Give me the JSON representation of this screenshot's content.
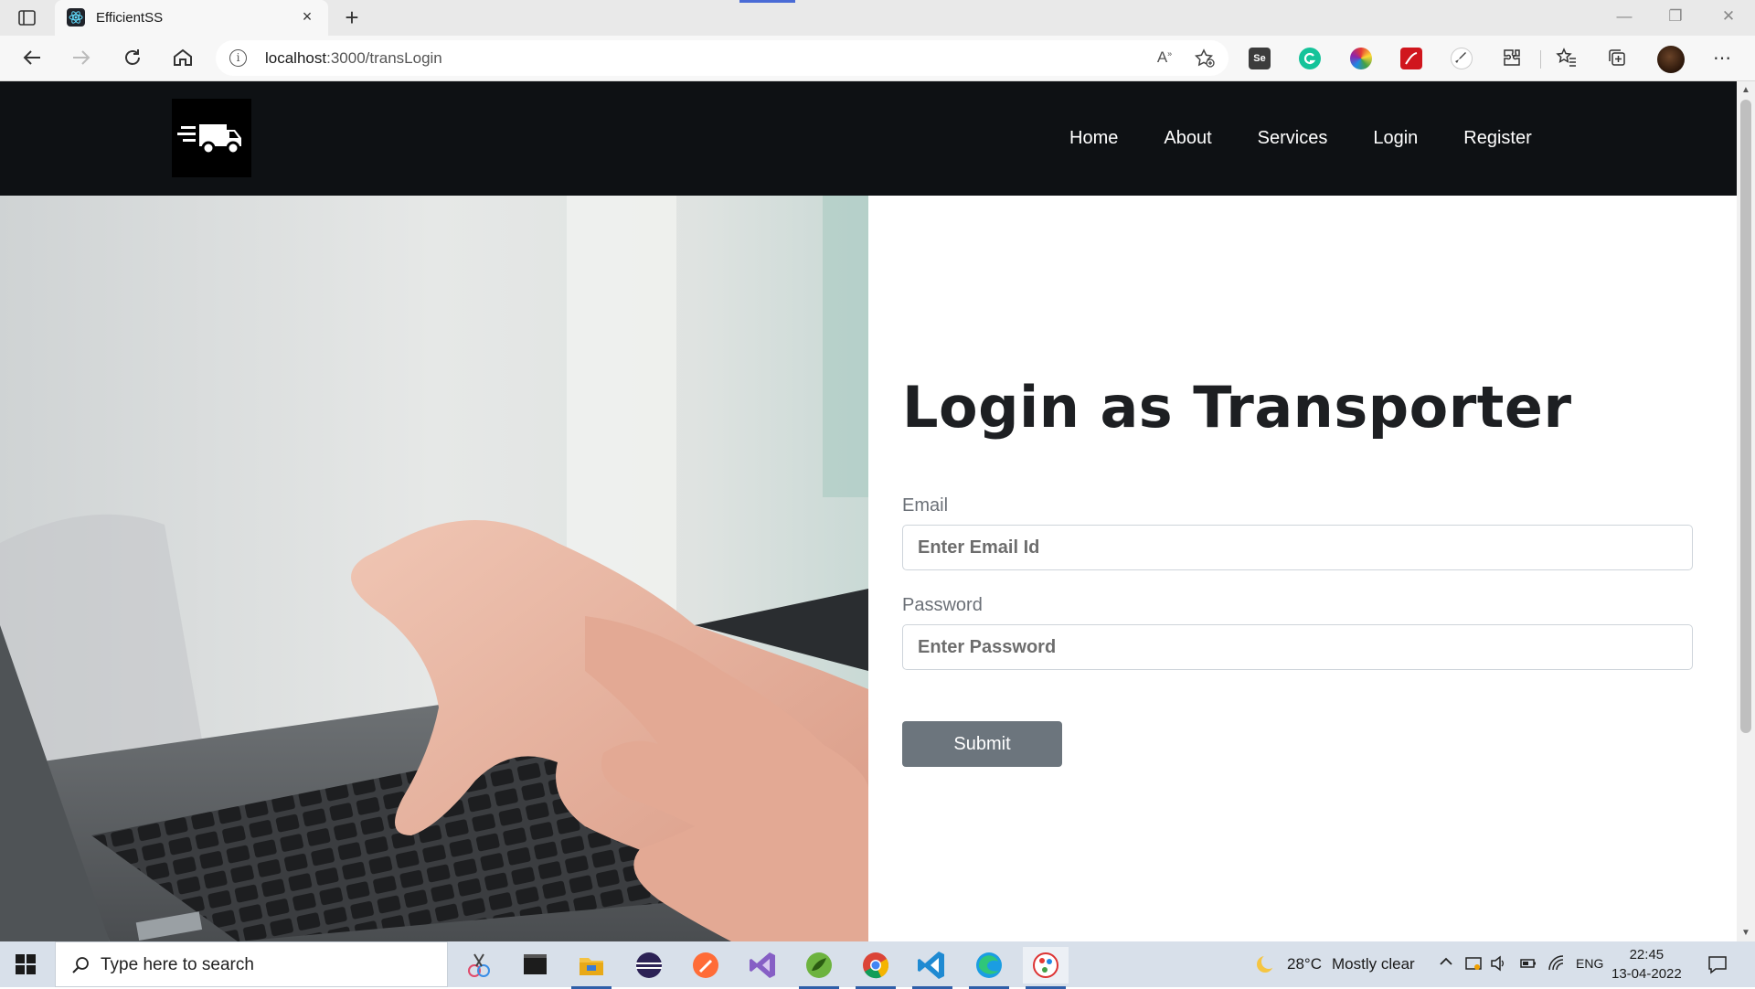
{
  "browser": {
    "tab_title": "EfficientSS",
    "tab_close": "×",
    "new_tab": "+",
    "url_host": "localhost",
    "url_path": ":3000/transLogin",
    "window_controls": {
      "minimize": "—",
      "restore": "❐",
      "close": "✕"
    },
    "extensions": [
      "selenium-ide-extension",
      "grammarly-extension",
      "color-picker-extension",
      "pdf-extension",
      "rocket-extension",
      "extensions-icon"
    ],
    "selenium_label": "Se"
  },
  "site": {
    "logo": "delivery-truck-logo",
    "nav": [
      "Home",
      "About",
      "Services",
      "Login",
      "Register"
    ]
  },
  "login_form": {
    "title": "Login as Transporter",
    "email_label": "Email",
    "email_placeholder": "Enter Email Id",
    "password_label": "Password",
    "password_placeholder": "Enter Password",
    "submit_label": "Submit"
  },
  "taskbar": {
    "search_placeholder": "Type here to search",
    "weather_temp": "28°C",
    "weather_desc": "Mostly clear",
    "language": "ENG",
    "time": "22:45",
    "date": "13-04-2022",
    "apps": [
      "snipping-tool",
      "terminal",
      "file-explorer",
      "eclipse",
      "postman",
      "visual-studio",
      "spring-tool-suite",
      "chrome",
      "vs-code",
      "edge",
      "paint"
    ]
  },
  "colors": {
    "navbar_bg": "#0e1114",
    "submit_bg": "#6c757d",
    "page_bg": "#ffffff"
  }
}
